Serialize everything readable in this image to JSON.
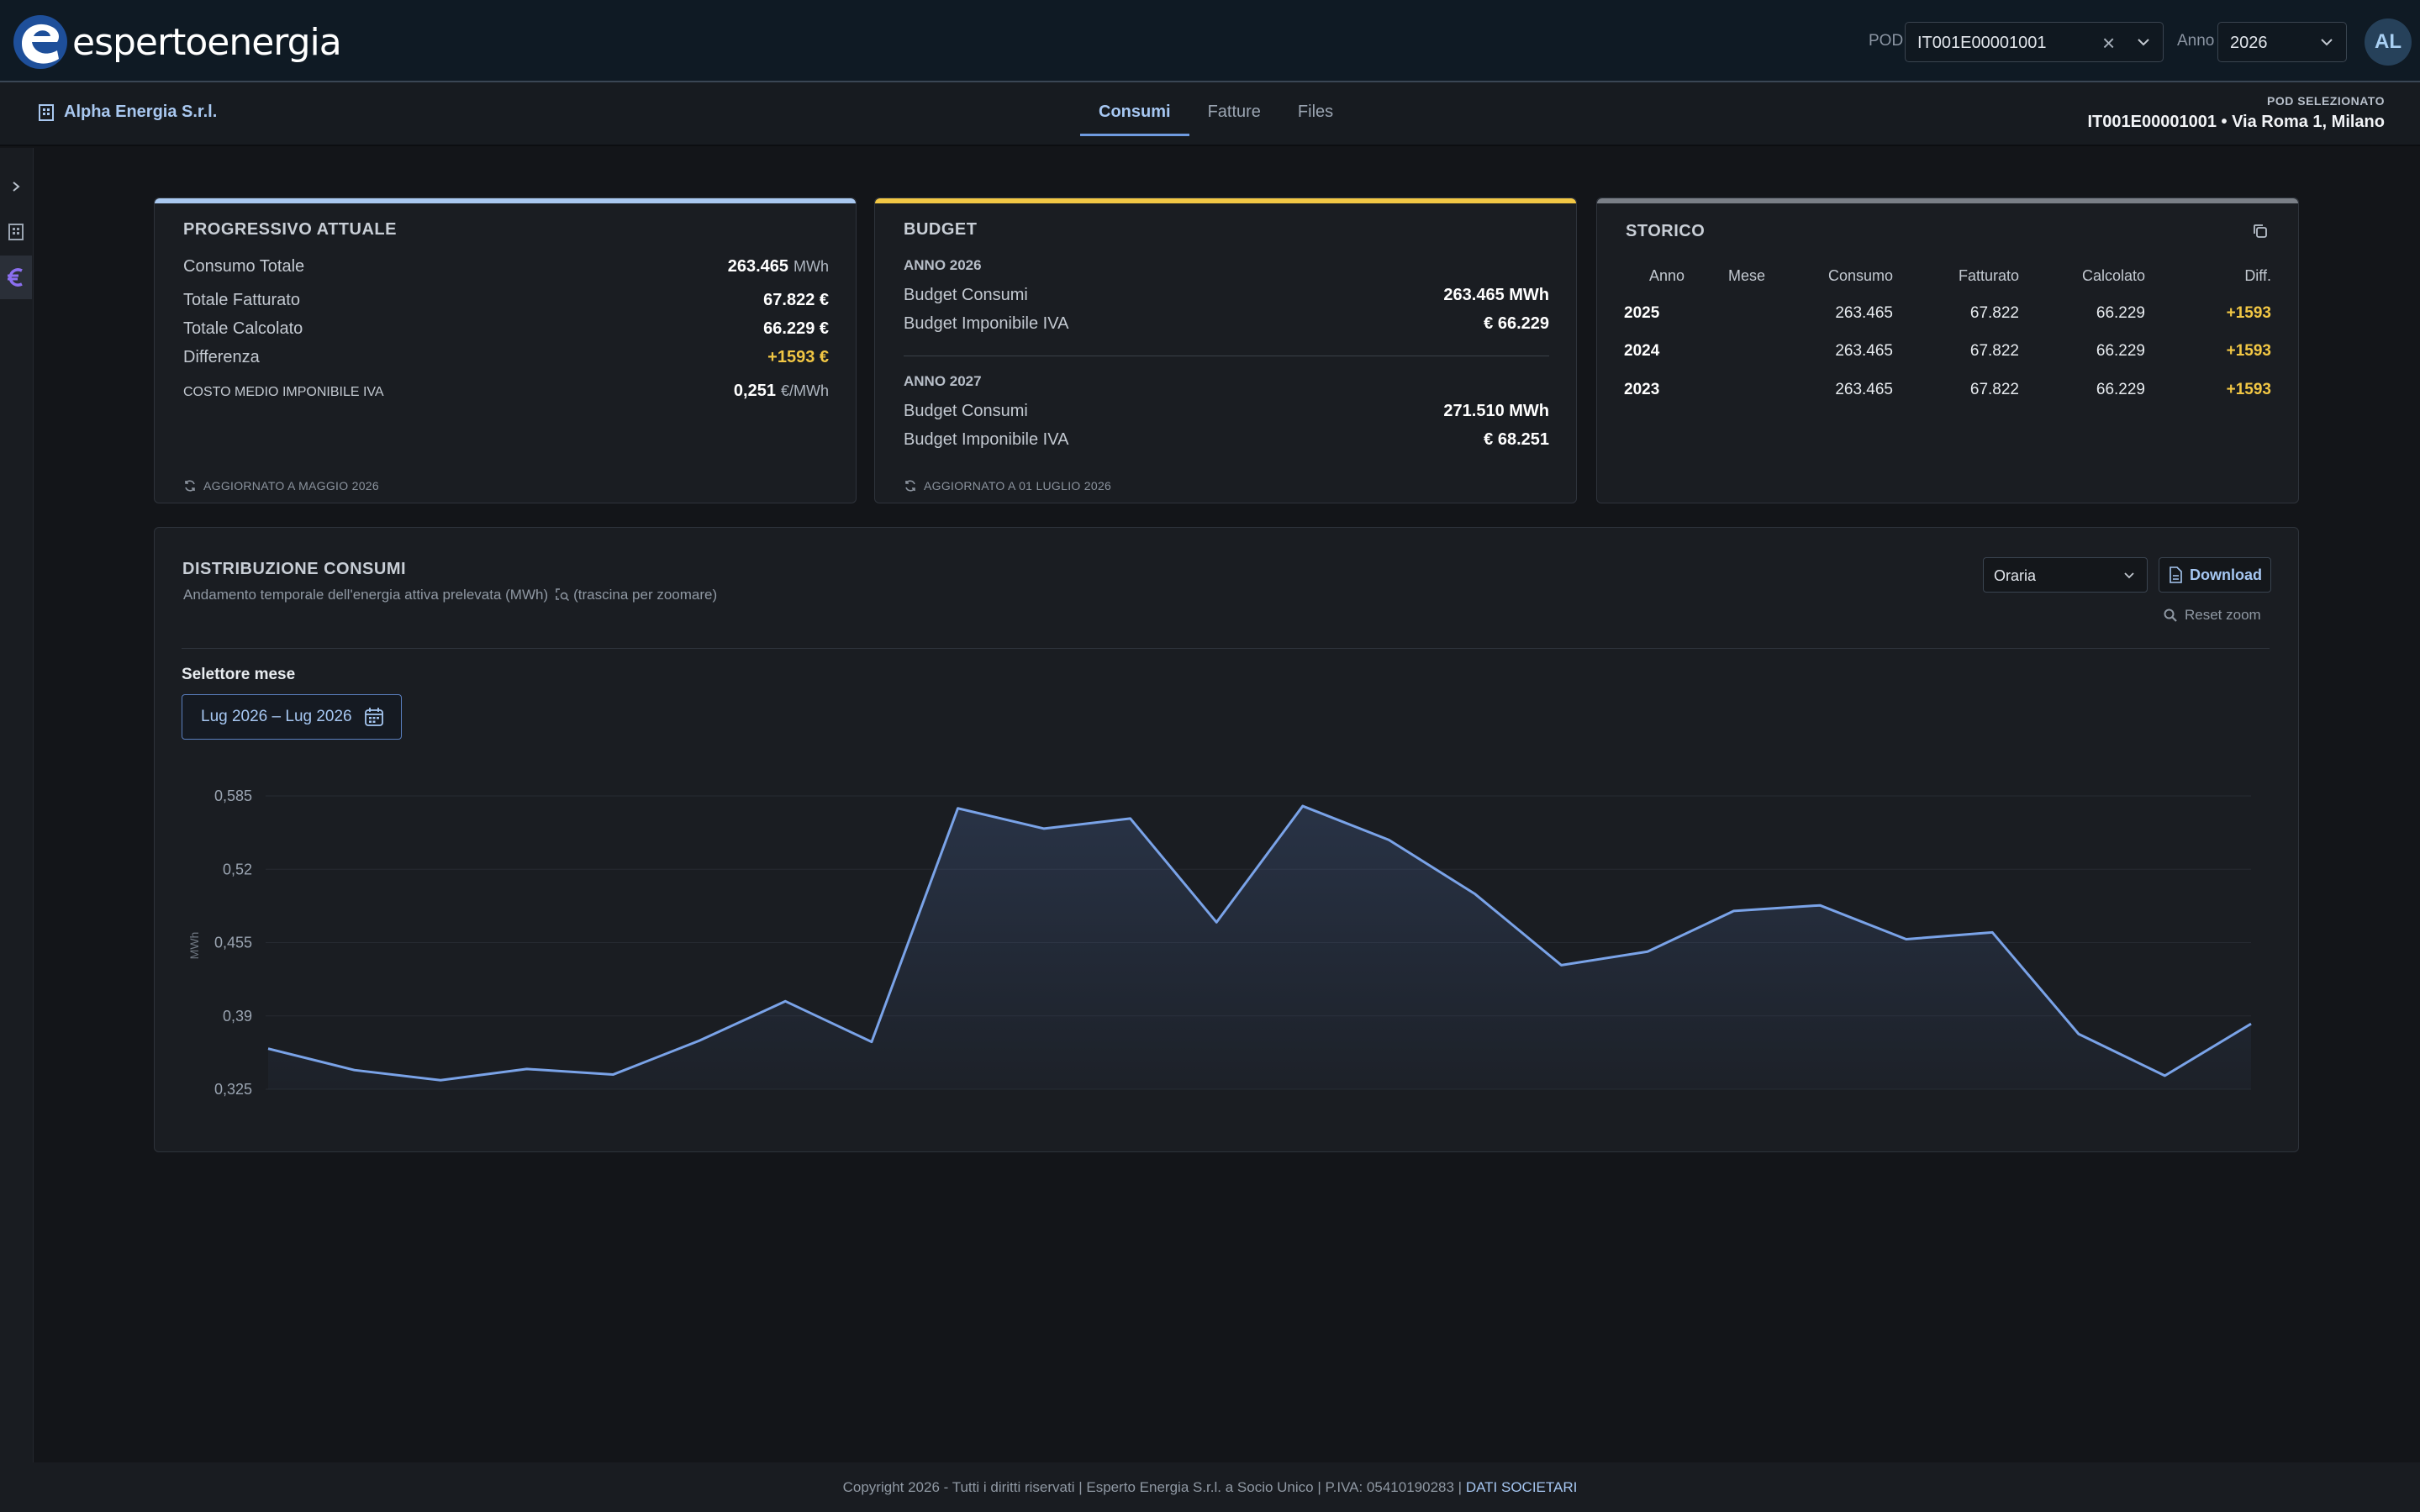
{
  "header": {
    "brand": "espertoenergia",
    "pod_label": "POD",
    "pod_value": "IT001E00001001",
    "anno_label": "Anno",
    "anno_value": "2026",
    "avatar": "AL"
  },
  "subheader": {
    "company": "Alpha Energia S.r.l.",
    "tabs": [
      {
        "label": "Consumi",
        "active": true
      },
      {
        "label": "Fatture",
        "active": false
      },
      {
        "label": "Files",
        "active": false
      }
    ],
    "pod_selected_label": "POD SELEZIONATO",
    "pod_selected_value": "IT001E00001001 • Via Roma 1, Milano"
  },
  "rail": {
    "items": [
      "chevron-right-icon",
      "building-icon",
      "euro-icon"
    ]
  },
  "progressivo": {
    "title": "PROGRESSIVO ATTUALE",
    "accent": "#a9c8f0",
    "consumo_label": "Consumo Totale",
    "consumo_value": "263.465",
    "consumo_unit": "MWh",
    "fatturato_label": "Totale Fatturato",
    "fatturato_value": "67.822 €",
    "calcolato_label": "Totale Calcolato",
    "calcolato_value": "66.229 €",
    "differenza_label": "Differenza",
    "differenza_value": "+1593 €",
    "costo_label": "COSTO MEDIO IMPONIBILE IVA",
    "costo_value": "0,251",
    "costo_unit": "€/MWh",
    "updated": "AGGIORNATO A MAGGIO 2026"
  },
  "budget": {
    "title": "BUDGET",
    "accent": "#f2c744",
    "y1_label": "ANNO 2026",
    "y1_consumi_label": "Budget Consumi",
    "y1_consumi_value": "263.465 MWh",
    "y1_iva_label": "Budget Imponibile IVA",
    "y1_iva_value": "€ 66.229",
    "y2_label": "ANNO 2027",
    "y2_consumi_label": "Budget Consumi",
    "y2_consumi_value": "271.510 MWh",
    "y2_iva_label": "Budget Imponibile IVA",
    "y2_iva_value": "€ 68.251",
    "updated": "AGGIORNATO A 01 LUGLIO 2026"
  },
  "storico": {
    "title": "STORICO",
    "accent": "#7a7f87",
    "columns": [
      "Anno",
      "Mese",
      "Consumo",
      "Fatturato",
      "Calcolato",
      "Diff."
    ],
    "rows": [
      {
        "anno": "2025",
        "mese": "",
        "consumo": "263.465",
        "fatturato": "67.822",
        "calcolato": "66.229",
        "diff": "+1593"
      },
      {
        "anno": "2024",
        "mese": "",
        "consumo": "263.465",
        "fatturato": "67.822",
        "calcolato": "66.229",
        "diff": "+1593"
      },
      {
        "anno": "2023",
        "mese": "",
        "consumo": "263.465",
        "fatturato": "67.822",
        "calcolato": "66.229",
        "diff": "+1593"
      }
    ]
  },
  "distribuzione": {
    "title": "DISTRIBUZIONE CONSUMI",
    "subtitle": "Andamento temporale dell'energia attiva prelevata (MWh)",
    "hint": "(trascina per zoomare)",
    "granularity": "Oraria",
    "download_label": "Download",
    "reset_label": "Reset zoom",
    "selector_label": "Selettore mese",
    "range_value": "Lug 2026 – Lug 2026"
  },
  "chart_data": {
    "type": "area",
    "ylabel": "MWh",
    "yticks": [
      "0,585",
      "0,52",
      "0,455",
      "0,39",
      "0,325"
    ],
    "ytick_values": [
      0.585,
      0.52,
      0.455,
      0.39,
      0.325
    ],
    "ylim": [
      0.325,
      0.585
    ],
    "grid": true,
    "line_color": "#7aa3e8",
    "values": [
      0.361,
      0.342,
      0.333,
      0.343,
      0.338,
      0.368,
      0.403,
      0.367,
      0.574,
      0.556,
      0.565,
      0.473,
      0.576,
      0.546,
      0.498,
      0.435,
      0.447,
      0.483,
      0.488,
      0.458,
      0.464,
      0.374,
      0.337,
      0.383
    ]
  },
  "footer": {
    "text": "Copyright 2026 - Tutti i diritti riservati | Esperto Energia S.r.l. a Socio Unico | P.IVA: 05410190283 |",
    "link": "DATI SOCIETARI"
  }
}
